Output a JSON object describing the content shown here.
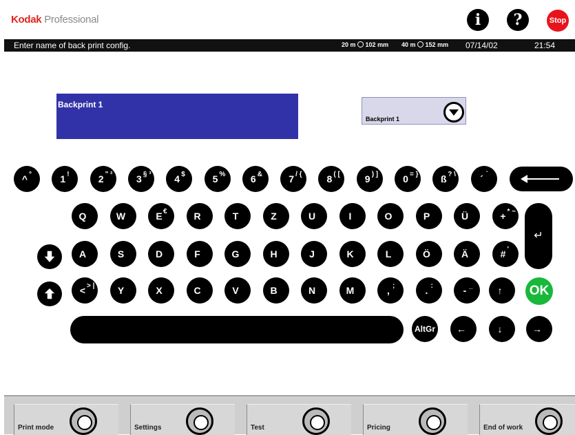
{
  "header": {
    "brand_bold": "Kodak",
    "brand_rest": " Professional",
    "info_label": "i",
    "help_label": "?",
    "stop_label": "Stop"
  },
  "status": {
    "prompt": "Enter name of back print config.",
    "media1": "20 m",
    "media1b": "102 mm",
    "media2": "40 m",
    "media2b": "152 mm",
    "date": "07/14/02",
    "time": "21:54"
  },
  "form": {
    "name_value": "Backprint 1",
    "dropdown_value": "Backprint 1"
  },
  "keyboard": {
    "row1": [
      {
        "main": "^",
        "alt": "°"
      },
      {
        "main": "1",
        "alt": "!"
      },
      {
        "main": "2",
        "alt": "\" ²"
      },
      {
        "main": "3",
        "alt": "§ ³"
      },
      {
        "main": "4",
        "alt": "$"
      },
      {
        "main": "5",
        "alt": "%"
      },
      {
        "main": "6",
        "alt": "&"
      },
      {
        "main": "7",
        "alt": "/ {"
      },
      {
        "main": "8",
        "alt": "( ["
      },
      {
        "main": "9",
        "alt": ") ]"
      },
      {
        "main": "0",
        "alt": "= }"
      },
      {
        "main": "ß",
        "alt": "? \\"
      },
      {
        "main": "´",
        "alt": "`"
      }
    ],
    "row2": [
      "Q",
      "W",
      "E",
      "R",
      "T",
      "Z",
      "U",
      "I",
      "O",
      "P",
      "Ü",
      "+"
    ],
    "row2_alt": {
      "E": "€",
      "+": "* ~"
    },
    "row3": [
      "A",
      "S",
      "D",
      "F",
      "G",
      "H",
      "J",
      "K",
      "L",
      "Ö",
      "Ä",
      "#"
    ],
    "row3_alt": {
      "#": "'"
    },
    "row4": [
      "<",
      "Y",
      "X",
      "C",
      "V",
      "B",
      "N",
      "M",
      ",",
      ".",
      "-"
    ],
    "row4_alt": {
      "<": "> |",
      ",": ";",
      ".": ":",
      "-": "_"
    },
    "altgr": "AltGr",
    "ok": "OK",
    "arrows": {
      "up": "↑",
      "left": "←",
      "down": "↓",
      "right": "→"
    },
    "enter_glyph": "↵"
  },
  "softkeys": [
    {
      "label": "Print mode"
    },
    {
      "label": "Settings"
    },
    {
      "label": "Test"
    },
    {
      "label": "Pricing"
    },
    {
      "label": "End of work"
    }
  ]
}
